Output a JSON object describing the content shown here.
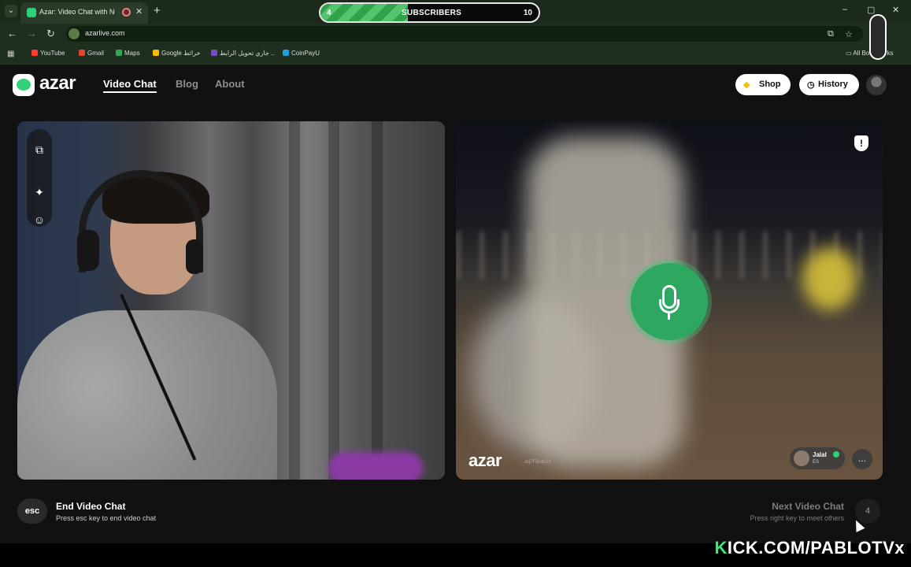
{
  "browser": {
    "tab": {
      "title": "Azar: Video Chat with New",
      "close": "✕"
    },
    "new_tab": "+",
    "window_controls": [
      "–",
      "▢",
      "✕"
    ],
    "url": "azarlive.com",
    "bookmarks": [
      {
        "label": "YouTube",
        "color": "#ff3b30"
      },
      {
        "label": "Gmail",
        "color": "#ea4335"
      },
      {
        "label": "Maps",
        "color": "#34a853"
      },
      {
        "label": "Google خرائط",
        "color": "#fbbc05"
      },
      {
        "label": "جاري تحويل الرابط ..",
        "color": "#7a4cc2"
      },
      {
        "label": "CoinPayU",
        "color": "#1fa0e0"
      }
    ],
    "all_bookmarks": "All Bookmarks"
  },
  "subscriber_goal": {
    "current": "4",
    "label": "SUBSCRIBERS",
    "goal": "10",
    "progress": 0.4
  },
  "site": {
    "logo": "azar",
    "nav": [
      "Video Chat",
      "Blog",
      "About"
    ],
    "shop_label": "Shop",
    "history_label": "History"
  },
  "remote": {
    "watermark": "azar",
    "room_id": "Aq7FBub2r1",
    "peer_name": "Jalal",
    "peer_country": "ES"
  },
  "controls": {
    "esc_key": "esc",
    "end_title": "End Video Chat",
    "end_hint": "Press esc key to end video chat",
    "next_title": "Next Video Chat",
    "next_hint": "Press right key to meet others",
    "next_key": "4"
  },
  "stream_overlay": {
    "kick_k": "K",
    "kick_rest": "ICK.COM/PABLOTVx"
  },
  "colors": {
    "accent": "#2fd27a",
    "mic": "#2ea861"
  }
}
